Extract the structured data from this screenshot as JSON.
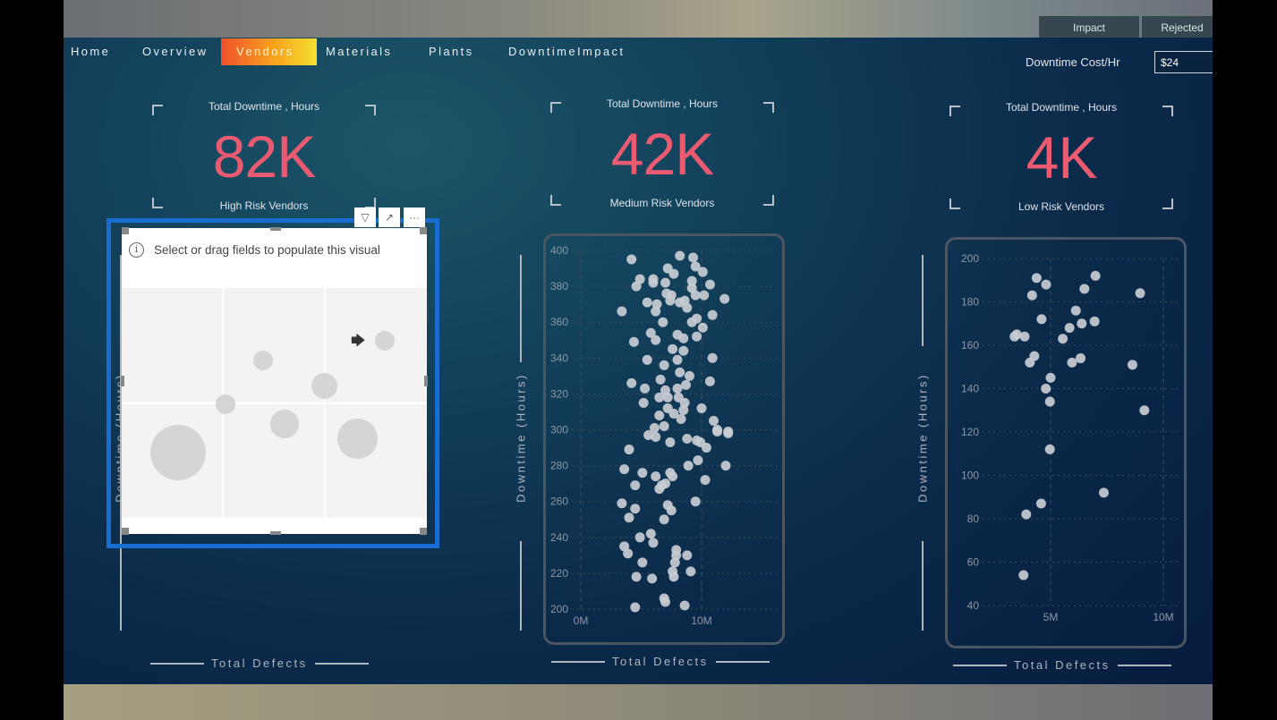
{
  "nav": {
    "items": [
      {
        "label": "Home"
      },
      {
        "label": "Overview"
      },
      {
        "label": "Vendors",
        "active": true
      },
      {
        "label": "Materials"
      },
      {
        "label": "Plants"
      },
      {
        "label": "DowntimeImpact"
      }
    ]
  },
  "tabs": [
    {
      "label": "Impact"
    },
    {
      "label": "Rejected"
    }
  ],
  "cost": {
    "label": "Downtime Cost/Hr",
    "value": "$24"
  },
  "kpis": [
    {
      "title": "Total Downtime , Hours",
      "value": "82K",
      "subtitle": "High Risk Vendors"
    },
    {
      "title": "Total Downtime , Hours",
      "value": "42K",
      "subtitle": "Medium Risk Vendors"
    },
    {
      "title": "Total Downtime , Hours",
      "value": "4K",
      "subtitle": "Low Risk Vendors"
    }
  ],
  "colors": {
    "accent": "#ea5b72",
    "selection": "#1a6dd0",
    "dot": "#c8ccd3",
    "nav_active_from": "#f0522c",
    "nav_active_to": "#f6e030"
  },
  "placeholder": {
    "message": "Select or drag fields to populate this visual",
    "icon": "info-icon",
    "toolbar": [
      "filter-icon",
      "focus-mode-icon",
      "more-options-icon"
    ],
    "more_label": "···"
  },
  "axes": {
    "y": "Downtime (Hours)",
    "x": "Total Defects"
  },
  "chart_data": [
    {
      "type": "scatter",
      "title": "Medium Risk Vendors",
      "xlabel": "Total Defects",
      "ylabel": "Downtime (Hours)",
      "xlim": [
        -0.7,
        15.6
      ],
      "ylim": [
        200,
        400
      ],
      "x_unit": "M",
      "xticks": [
        "0M",
        "10M"
      ],
      "xtick_values": [
        0,
        10
      ],
      "yticks": [
        200,
        220,
        240,
        260,
        280,
        300,
        320,
        340,
        360,
        380,
        400
      ],
      "grid": true,
      "points": [
        [
          4.2,
          395
        ],
        [
          8.2,
          397
        ],
        [
          9.3,
          396
        ],
        [
          7.2,
          390
        ],
        [
          7.7,
          387
        ],
        [
          9.5,
          391
        ],
        [
          10.1,
          388
        ],
        [
          4.9,
          384
        ],
        [
          4.6,
          380
        ],
        [
          6.0,
          384
        ],
        [
          6.0,
          382
        ],
        [
          7.0,
          382
        ],
        [
          9.2,
          383
        ],
        [
          10.7,
          381
        ],
        [
          7.1,
          376
        ],
        [
          7.5,
          375
        ],
        [
          9.2,
          379
        ],
        [
          9.5,
          375
        ],
        [
          10.2,
          375
        ],
        [
          11.9,
          373
        ],
        [
          5.5,
          371
        ],
        [
          6.3,
          370
        ],
        [
          7.4,
          372
        ],
        [
          8.2,
          371
        ],
        [
          8.6,
          372
        ],
        [
          8.8,
          368
        ],
        [
          6.2,
          366
        ],
        [
          3.4,
          366
        ],
        [
          10.9,
          364
        ],
        [
          9.6,
          362
        ],
        [
          9.2,
          360
        ],
        [
          6.8,
          360
        ],
        [
          10.1,
          357
        ],
        [
          5.8,
          354
        ],
        [
          6.2,
          350
        ],
        [
          8.0,
          353
        ],
        [
          8.5,
          351
        ],
        [
          9.6,
          352
        ],
        [
          4.4,
          349
        ],
        [
          7.6,
          345
        ],
        [
          8.5,
          344
        ],
        [
          5.5,
          339
        ],
        [
          8.0,
          339
        ],
        [
          10.9,
          340
        ],
        [
          6.9,
          336
        ],
        [
          8.2,
          332
        ],
        [
          9.0,
          330
        ],
        [
          8.7,
          325
        ],
        [
          4.2,
          326
        ],
        [
          6.6,
          328
        ],
        [
          10.7,
          327
        ],
        [
          5.3,
          323
        ],
        [
          8.0,
          323
        ],
        [
          7.0,
          322
        ],
        [
          6.5,
          318
        ],
        [
          7.2,
          318
        ],
        [
          8.1,
          318
        ],
        [
          8.6,
          315
        ],
        [
          5.2,
          315
        ],
        [
          7.2,
          312
        ],
        [
          8.5,
          311
        ],
        [
          10.0,
          312
        ],
        [
          6.5,
          308
        ],
        [
          7.7,
          309
        ],
        [
          8.3,
          306
        ],
        [
          6.9,
          302
        ],
        [
          11.0,
          305
        ],
        [
          11.3,
          300
        ],
        [
          12.2,
          299
        ],
        [
          6.1,
          301
        ],
        [
          5.6,
          297
        ],
        [
          6.2,
          296
        ],
        [
          11.3,
          299
        ],
        [
          12.2,
          298
        ],
        [
          7.4,
          293
        ],
        [
          8.8,
          295
        ],
        [
          9.6,
          294
        ],
        [
          9.9,
          293
        ],
        [
          10.4,
          290
        ],
        [
          4.0,
          289
        ],
        [
          9.7,
          283
        ],
        [
          8.9,
          280
        ],
        [
          12.0,
          280
        ],
        [
          3.6,
          278
        ],
        [
          5.1,
          276
        ],
        [
          7.4,
          276
        ],
        [
          7.6,
          274
        ],
        [
          6.2,
          274
        ],
        [
          10.3,
          272
        ],
        [
          7.0,
          270
        ],
        [
          6.7,
          269
        ],
        [
          6.5,
          267
        ],
        [
          4.5,
          269
        ],
        [
          9.5,
          260
        ],
        [
          3.4,
          259
        ],
        [
          7.2,
          258
        ],
        [
          7.5,
          255
        ],
        [
          4.5,
          256
        ],
        [
          4.0,
          251
        ],
        [
          6.9,
          250
        ],
        [
          5.8,
          242
        ],
        [
          4.9,
          240
        ],
        [
          6.0,
          237
        ],
        [
          3.6,
          235
        ],
        [
          3.9,
          231
        ],
        [
          7.9,
          233
        ],
        [
          7.9,
          230
        ],
        [
          8.8,
          230
        ],
        [
          7.8,
          226
        ],
        [
          5.1,
          226
        ],
        [
          7.6,
          221
        ],
        [
          9.1,
          221
        ],
        [
          7.7,
          218
        ],
        [
          4.6,
          218
        ],
        [
          5.9,
          217
        ],
        [
          6.9,
          206
        ],
        [
          7.0,
          204
        ],
        [
          8.6,
          202
        ],
        [
          4.5,
          201
        ]
      ]
    },
    {
      "type": "scatter",
      "title": "Low Risk Vendors",
      "xlabel": "Total Defects",
      "ylabel": "Downtime (Hours)",
      "xlim": [
        0.3,
        10.9
      ],
      "ylim": [
        40,
        200
      ],
      "x_unit": "M",
      "xticks": [
        "5M",
        "10M"
      ],
      "xtick_values": [
        5,
        10
      ],
      "yticks": [
        40,
        60,
        80,
        100,
        120,
        140,
        160,
        180,
        200
      ],
      "grid": true,
      "points": [
        [
          4.38,
          191
        ],
        [
          4.8,
          188
        ],
        [
          4.18,
          183
        ],
        [
          6.99,
          192
        ],
        [
          6.5,
          186
        ],
        [
          8.97,
          184
        ],
        [
          6.12,
          176
        ],
        [
          4.6,
          172
        ],
        [
          6.95,
          171
        ],
        [
          6.38,
          170
        ],
        [
          5.84,
          168
        ],
        [
          3.4,
          164
        ],
        [
          3.5,
          165
        ],
        [
          3.85,
          164
        ],
        [
          5.54,
          163
        ],
        [
          4.28,
          155
        ],
        [
          4.08,
          152
        ],
        [
          5.95,
          152
        ],
        [
          6.33,
          154
        ],
        [
          8.63,
          151
        ],
        [
          5.0,
          145
        ],
        [
          4.79,
          140
        ],
        [
          4.97,
          134
        ],
        [
          9.16,
          130
        ],
        [
          4.97,
          112
        ],
        [
          7.36,
          92
        ],
        [
          4.58,
          87
        ],
        [
          3.92,
          82
        ],
        [
          3.8,
          54
        ]
      ]
    }
  ]
}
